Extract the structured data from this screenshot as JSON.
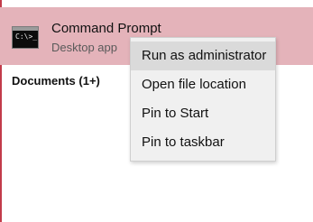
{
  "search_results": {
    "best_match": {
      "title": "Command Prompt",
      "subtitle": "Desktop app",
      "icon": "command-prompt-icon",
      "icon_glyph": "C:\\>_"
    },
    "sections": [
      {
        "label": "Documents (1+)"
      }
    ]
  },
  "context_menu": {
    "items": [
      {
        "label": "Run as administrator",
        "highlighted": true
      },
      {
        "label": "Open file location",
        "highlighted": false
      },
      {
        "label": "Pin to Start",
        "highlighted": false
      },
      {
        "label": "Pin to taskbar",
        "highlighted": false
      }
    ]
  },
  "colors": {
    "selection_bg": "#e4b3ba",
    "accent_border": "#c23b4a",
    "menu_bg": "#f0f0f0",
    "menu_hover": "#dadada"
  }
}
